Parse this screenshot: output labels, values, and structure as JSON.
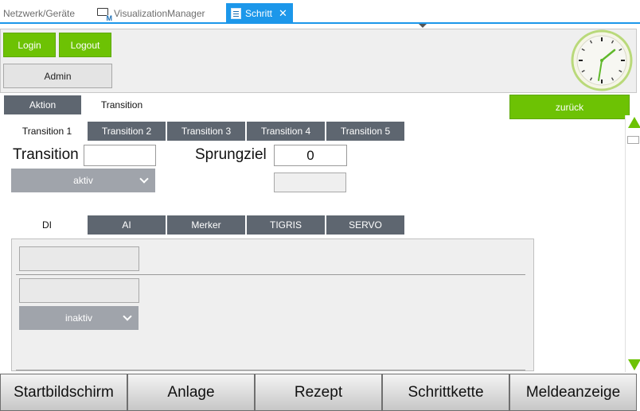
{
  "doc_tabs": {
    "tab1": "Netzwerk/Geräte",
    "tab2": "VisualizationManager",
    "tab3": "Schritt",
    "close": "✕"
  },
  "header": {
    "login": "Login",
    "logout": "Logout",
    "admin": "Admin"
  },
  "section_tabs": {
    "aktion": "Aktion",
    "transition": "Transition"
  },
  "back_button": "zurück",
  "transition_tabs": [
    "Transition 1",
    "Transition 2",
    "Transition 3",
    "Transition 4",
    "Transition 5"
  ],
  "transition_form": {
    "transition_label": "Transition",
    "transition_value": "",
    "sprungziel_label": "Sprungziel",
    "sprungziel_value": "0",
    "status_dropdown": "aktiv"
  },
  "io_tabs": [
    "DI",
    "AI",
    "Merker",
    "TIGRIS",
    "SERVO"
  ],
  "io_panel": {
    "status_dropdown": "inaktiv"
  },
  "bottom_nav": [
    "Startbildschirm",
    "Anlage",
    "Rezept",
    "Schrittkette",
    "Meldeanzeige"
  ],
  "colors": {
    "accent_green": "#6dc204",
    "tab_dark": "#5e6670",
    "doc_tab_active": "#1c97ea",
    "dropdown": "#a0a4ab"
  }
}
